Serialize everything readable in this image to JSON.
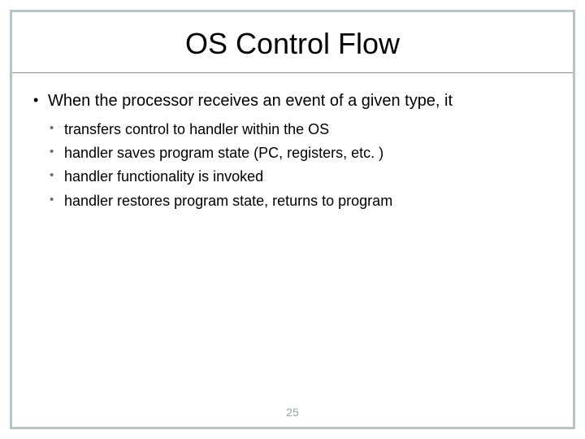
{
  "slide": {
    "title": "OS Control Flow",
    "main_bullet": "When the processor receives an event of a given type, it",
    "sub_bullets": [
      "transfers control to handler within the OS",
      "handler saves program state (PC, registers, etc. )",
      "handler functionality is invoked",
      "handler restores program state, returns to program"
    ],
    "page_number": "25"
  }
}
